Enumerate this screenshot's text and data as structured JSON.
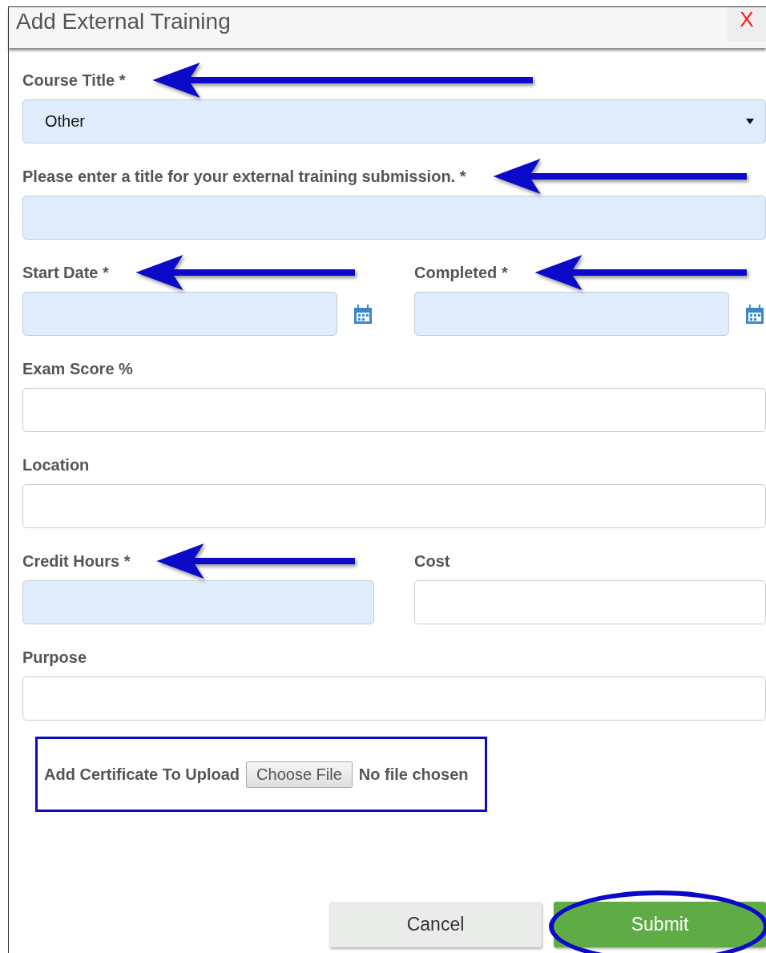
{
  "dialog": {
    "title": "Add External Training",
    "close": "X"
  },
  "rows": [
    {
      "fields": [
        {
          "label": "Course Title *",
          "kind": "select",
          "value": "Other",
          "required": true,
          "arrow": true
        }
      ]
    },
    {
      "fields": [
        {
          "label": "Please enter a title for your external training submission. *",
          "kind": "text",
          "required": true,
          "arrow": true
        }
      ]
    },
    {
      "fields": [
        {
          "label": "Start Date *",
          "kind": "date",
          "required": true,
          "arrow": true
        },
        {
          "label": "Completed *",
          "kind": "date",
          "required": true,
          "arrow": true
        }
      ]
    },
    {
      "fields": [
        {
          "label": "Exam Score %",
          "kind": "text",
          "required": false,
          "arrow": false
        }
      ]
    },
    {
      "fields": [
        {
          "label": "Location",
          "kind": "text",
          "required": false,
          "arrow": false
        }
      ]
    },
    {
      "fields": [
        {
          "label": "Credit Hours *",
          "kind": "text",
          "required": true,
          "arrow": true
        },
        {
          "label": "Cost",
          "kind": "text",
          "required": false,
          "arrow": false
        }
      ]
    },
    {
      "fields": [
        {
          "label": "Purpose",
          "kind": "text",
          "required": false,
          "arrow": false
        }
      ]
    }
  ],
  "upload": {
    "label": "Add Certificate To Upload",
    "button": "Choose File",
    "status": "No file chosen",
    "annotated": true
  },
  "buttons": [
    {
      "label": "Cancel",
      "kind": "secondary",
      "annotated": false
    },
    {
      "label": "Submit",
      "kind": "primary",
      "annotated": true
    }
  ]
}
